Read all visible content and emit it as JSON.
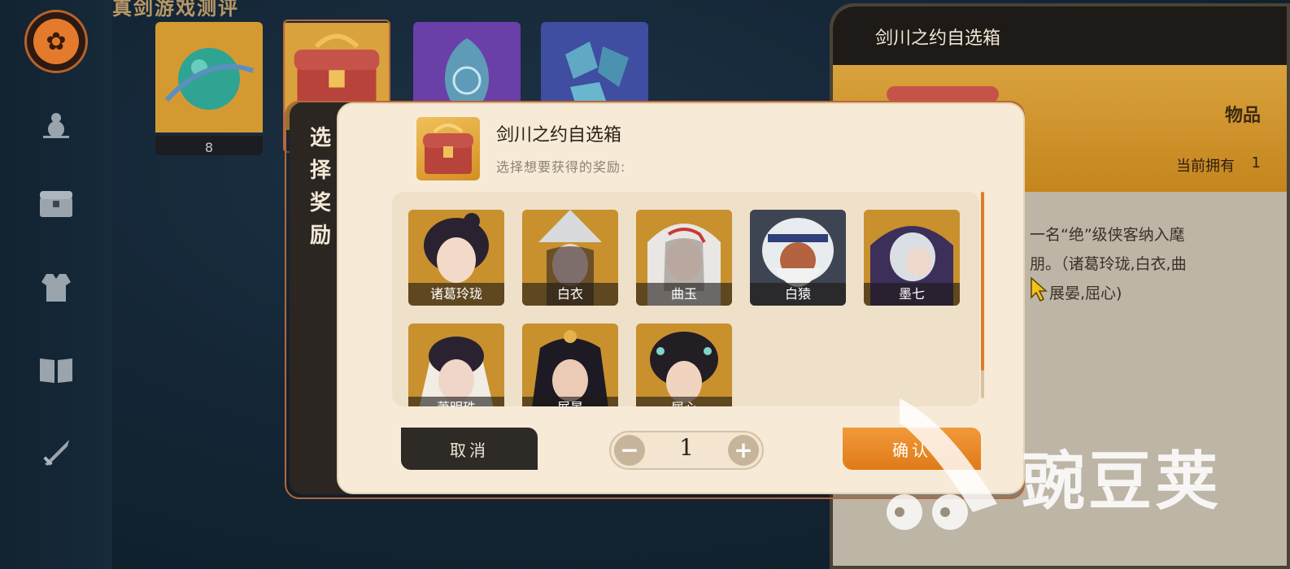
{
  "top_title": "真剑游戏测评",
  "items": [
    {
      "count": "8"
    }
  ],
  "detail": {
    "title": "剑川之约自选箱",
    "category": "物品",
    "own_label": "当前拥有",
    "own_value": "1",
    "desc_line1": "一名“绝”级侠客纳入麾",
    "desc_line2": "朋。（诸葛玲珑,白衣,曲",
    "desc_line3": "展晏,屈心)"
  },
  "modal": {
    "tab_label": [
      "选",
      "择",
      "奖",
      "励"
    ],
    "title": "剑川之约自选箱",
    "subtitle": "选择想要获得的奖励:",
    "heroes": [
      {
        "name": "诸葛玲珑"
      },
      {
        "name": "白衣"
      },
      {
        "name": "曲玉"
      },
      {
        "name": "白猿"
      },
      {
        "name": "墨七"
      },
      {
        "name": "萧明珠"
      },
      {
        "name": "展晏"
      },
      {
        "name": "屈心"
      }
    ],
    "cancel_label": "取消",
    "confirm_label": "确认",
    "minus": "−",
    "plus": "+",
    "quantity": "1"
  },
  "watermark": "豌豆荚",
  "colors": {
    "accent": "#e27a2a",
    "gold": "#d9a23d",
    "dark": "#2e2a26",
    "cream": "#f7ead7"
  }
}
